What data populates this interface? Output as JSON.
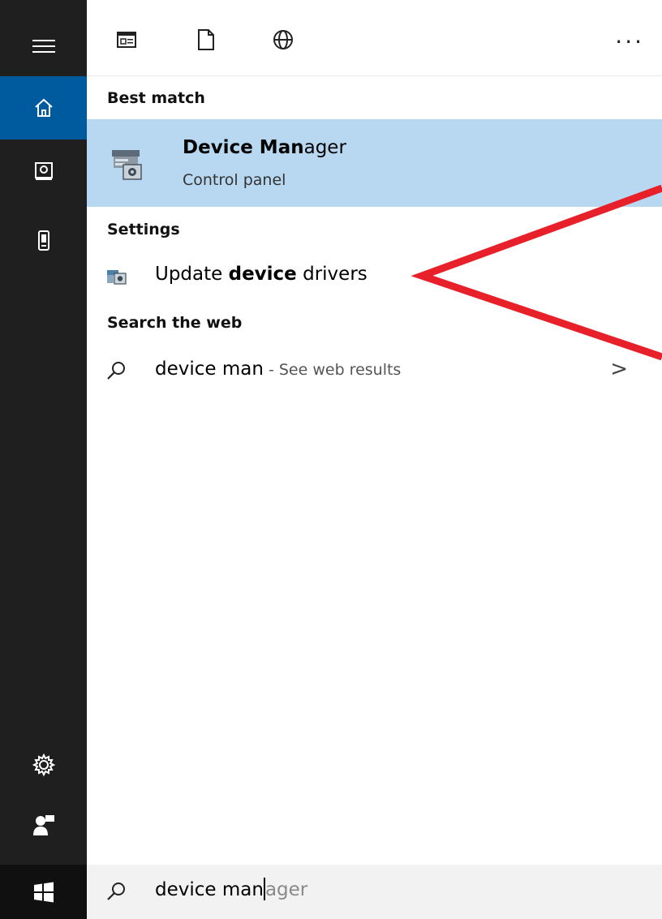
{
  "rail": {
    "items": [
      {
        "name": "menu",
        "icon": "hamburger-icon"
      },
      {
        "name": "home",
        "icon": "home-icon",
        "active": true
      },
      {
        "name": "notebook",
        "icon": "notebook-icon"
      },
      {
        "name": "devices",
        "icon": "phone-icon"
      }
    ],
    "bottom": [
      {
        "name": "settings",
        "icon": "gear-icon"
      },
      {
        "name": "feedback",
        "icon": "feedback-person-icon"
      }
    ],
    "start": {
      "icon": "windows-logo-icon"
    }
  },
  "toolbar": {
    "filters": [
      {
        "name": "apps",
        "icon": "apps-filter-icon"
      },
      {
        "name": "documents",
        "icon": "document-filter-icon"
      },
      {
        "name": "web",
        "icon": "globe-filter-icon"
      }
    ],
    "more_label": "..."
  },
  "results": {
    "best_match_header": "Best match",
    "best_match": {
      "title_bold": "Device Man",
      "title_rest": "ager",
      "subtitle": "Control panel",
      "icon": "device-manager-icon"
    },
    "settings_header": "Settings",
    "settings_item": {
      "pre": "Update ",
      "bold": "device",
      "post": " drivers",
      "icon": "device-settings-icon"
    },
    "web_header": "Search the web",
    "web_item": {
      "query": "device man",
      "suffix": " - See web results",
      "chevron": ">"
    }
  },
  "search": {
    "typed": "device man",
    "suggestion": "ager"
  },
  "colors": {
    "rail_bg": "#1f1f1f",
    "active_accent": "#005a9e",
    "highlight": "#b8d8f2",
    "annotation": "#e8202a"
  }
}
